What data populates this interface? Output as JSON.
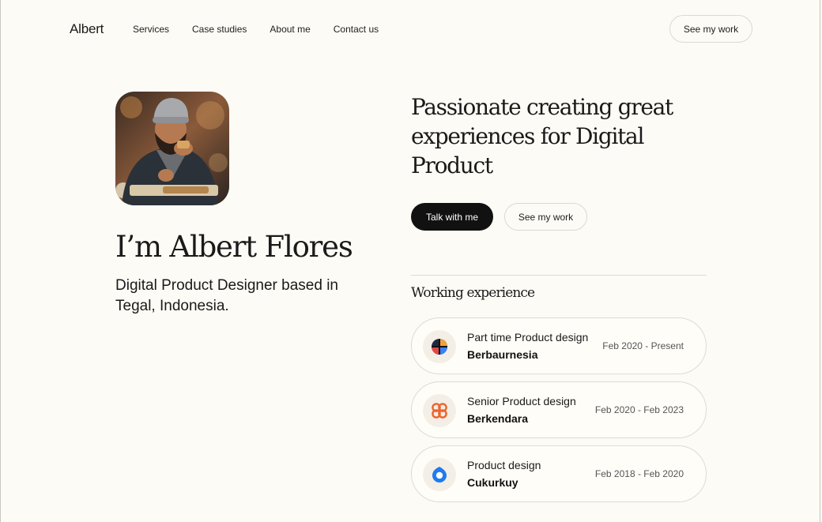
{
  "header": {
    "logo": "Albert",
    "nav": [
      "Services",
      "Case studies",
      "About me",
      "Contact us"
    ],
    "cta": "See my work"
  },
  "hero": {
    "avatar_alt": "Portrait photo",
    "name": "I’m Albert Flores",
    "bio": "Digital Product Designer based in Tegal, Indonesia.",
    "headline": "Passionate creating great experiences for Digital Product",
    "primary_button": "Talk with me",
    "secondary_button": "See my work"
  },
  "experience": {
    "heading": "Working experience",
    "items": [
      {
        "role": "Part time Product design",
        "company": "Berbaurnesia",
        "dates": "Feb 2020 - Present",
        "icon": "berbaurnesia-logo-icon"
      },
      {
        "role": "Senior Product design",
        "company": "Berkendara",
        "dates": "Feb 2020 - Feb 2023",
        "icon": "berkendara-logo-icon"
      },
      {
        "role": "Product design",
        "company": "Cukurkuy",
        "dates": "Feb 2018 - Feb 2020",
        "icon": "cukurkuy-logo-icon"
      }
    ]
  },
  "colors": {
    "background": "#fdfbf5",
    "text": "#1a1a1a",
    "primary_button": "#111111",
    "border": "#dedbd3",
    "orange_accent": "#f0622c",
    "blue_accent": "#1e7bf0"
  }
}
